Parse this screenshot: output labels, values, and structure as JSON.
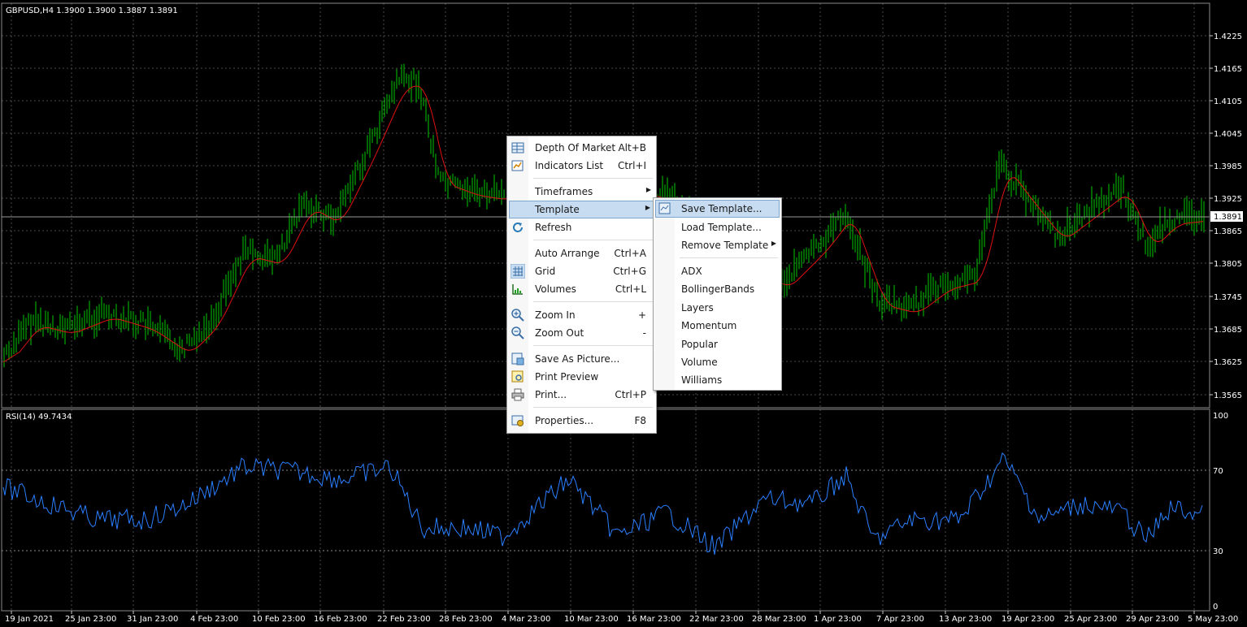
{
  "chart_header": "GBPUSD,H4  1.3900 1.3900 1.3887 1.3891",
  "rsi_header": "RSI(14) 49.7434",
  "current_price_label": "1.3891",
  "price_axis": [
    "1.4225",
    "1.4165",
    "1.4105",
    "1.4045",
    "1.3985",
    "1.3925",
    "1.3865",
    "1.3805",
    "1.3745",
    "1.3685",
    "1.3625",
    "1.3565"
  ],
  "rsi_axis": [
    "100",
    "70",
    "30",
    "0"
  ],
  "time_axis": [
    "19 Jan 2021",
    "25 Jan 23:00",
    "31 Jan 23:00",
    "4 Feb 23:00",
    "10 Feb 23:00",
    "16 Feb 23:00",
    "22 Feb 23:00",
    "28 Feb 23:00",
    "4 Mar 23:00",
    "10 Mar 23:00",
    "16 Mar 23:00",
    "22 Mar 23:00",
    "28 Mar 23:00",
    "1 Apr 23:00",
    "7 Apr 23:00",
    "13 Apr 23:00",
    "19 Apr 23:00",
    "25 Apr 23:00",
    "29 Apr 23:00",
    "5 May 23:00"
  ],
  "colors": {
    "background": "#000000",
    "grid": "#4a4a4a",
    "candles": "#00c800",
    "moving_average": "#e01010",
    "rsi_line": "#2a7fff",
    "axis_text": "#ffffff",
    "menu_highlight": "#c7dcf0"
  },
  "context_menu": {
    "items": [
      {
        "label": "Depth Of Market",
        "shortcut": "Alt+B",
        "icon": "depth-of-market-icon"
      },
      {
        "label": "Indicators List",
        "shortcut": "Ctrl+I",
        "icon": "indicators-list-icon"
      },
      {
        "label": "Timeframes",
        "submenu": true
      },
      {
        "label": "Template",
        "submenu": true,
        "highlighted": true
      },
      {
        "label": "Refresh",
        "icon": "refresh-icon"
      },
      {
        "label": "Auto Arrange",
        "shortcut": "Ctrl+A"
      },
      {
        "label": "Grid",
        "shortcut": "Ctrl+G",
        "icon": "grid-icon",
        "checked": true
      },
      {
        "label": "Volumes",
        "shortcut": "Ctrl+L",
        "icon": "volumes-icon"
      },
      {
        "label": "Zoom In",
        "shortcut": "+",
        "icon": "zoom-in-icon"
      },
      {
        "label": "Zoom Out",
        "shortcut": "-",
        "icon": "zoom-out-icon"
      },
      {
        "label": "Save As Picture...",
        "icon": "save-picture-icon"
      },
      {
        "label": "Print Preview",
        "icon": "print-preview-icon"
      },
      {
        "label": "Print...",
        "shortcut": "Ctrl+P",
        "icon": "print-icon"
      },
      {
        "label": "Properties...",
        "shortcut": "F8",
        "icon": "properties-icon"
      }
    ]
  },
  "template_submenu": {
    "items": [
      {
        "label": "Save Template...",
        "highlighted": true,
        "icon": "save-template-icon"
      },
      {
        "label": "Load Template..."
      },
      {
        "label": "Remove Template",
        "submenu": true
      },
      {
        "label": "ADX"
      },
      {
        "label": "BollingerBands"
      },
      {
        "label": "Layers"
      },
      {
        "label": "Momentum"
      },
      {
        "label": "Popular"
      },
      {
        "label": "Volume"
      },
      {
        "label": "Williams"
      }
    ]
  }
}
